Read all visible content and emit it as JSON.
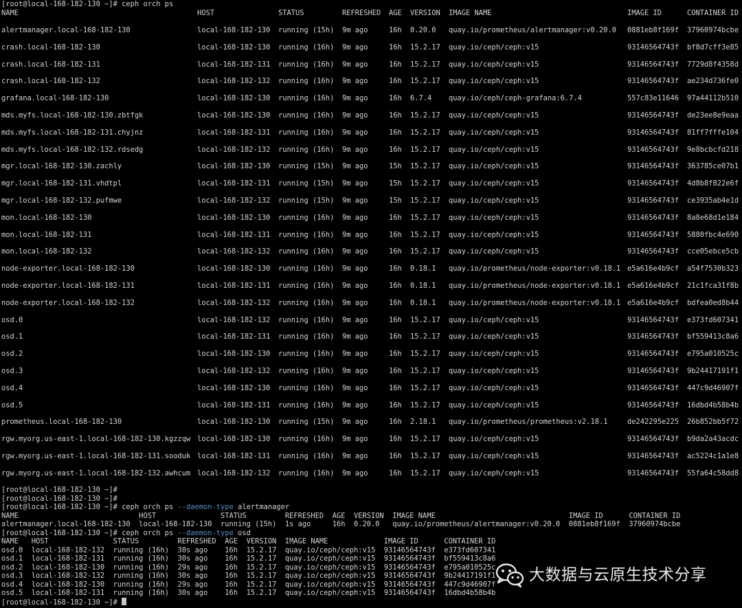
{
  "top_partial": "[root@local-168-182-130 ~]# ceph orch ps",
  "ps_all": {
    "headers": [
      "NAME",
      "HOST",
      "STATUS",
      "REFRESHED",
      "AGE",
      "VERSION",
      "IMAGE NAME",
      "IMAGE ID",
      "CONTAINER ID"
    ],
    "rows": [
      [
        "alertmanager.local-168-182-130",
        "local-168-182-130",
        "running (15h)",
        "9m ago",
        "16h",
        "0.20.0",
        "quay.io/prometheus/alertmanager:v0.20.0",
        "0881eb8f169f",
        "37960974bcbe"
      ],
      [
        "crash.local-168-182-130",
        "local-168-182-130",
        "running (16h)",
        "9m ago",
        "16h",
        "15.2.17",
        "quay.io/ceph/ceph:v15",
        "93146564743f",
        "bf8d7cff3e85"
      ],
      [
        "crash.local-168-182-131",
        "local-168-182-131",
        "running (16h)",
        "9m ago",
        "16h",
        "15.2.17",
        "quay.io/ceph/ceph:v15",
        "93146564743f",
        "7729d8f4358d"
      ],
      [
        "crash.local-168-182-132",
        "local-168-182-132",
        "running (16h)",
        "9m ago",
        "16h",
        "15.2.17",
        "quay.io/ceph/ceph:v15",
        "93146564743f",
        "ae234d736fe0"
      ],
      [
        "grafana.local-168-182-130",
        "local-168-182-130",
        "running (16h)",
        "9m ago",
        "16h",
        "6.7.4",
        "quay.io/ceph/ceph-grafana:6.7.4",
        "557c83e11646",
        "97a44112b510"
      ],
      [
        "mds.myfs.local-168-182-130.zbtfgk",
        "local-168-182-130",
        "running (16h)",
        "9m ago",
        "16h",
        "15.2.17",
        "quay.io/ceph/ceph:v15",
        "93146564743f",
        "de23ee8e9eaa"
      ],
      [
        "mds.myfs.local-168-182-131.chyjnz",
        "local-168-182-131",
        "running (16h)",
        "9m ago",
        "16h",
        "15.2.17",
        "quay.io/ceph/ceph:v15",
        "93146564743f",
        "81ff7fffe104"
      ],
      [
        "mds.myfs.local-168-182-132.rdsedg",
        "local-168-182-132",
        "running (16h)",
        "9m ago",
        "16h",
        "15.2.17",
        "quay.io/ceph/ceph:v15",
        "93146564743f",
        "9e8bcbcfd218"
      ],
      [
        "mgr.local-168-182-130.zachly",
        "local-168-182-130",
        "running (15h)",
        "9m ago",
        "15h",
        "15.2.17",
        "quay.io/ceph/ceph:v15",
        "93146564743f",
        "363785ce07b1"
      ],
      [
        "mgr.local-168-182-131.vhdtpl",
        "local-168-182-131",
        "running (15h)",
        "9m ago",
        "15h",
        "15.2.17",
        "quay.io/ceph/ceph:v15",
        "93146564743f",
        "4d8b8f822e6f"
      ],
      [
        "mgr.local-168-182-132.pufmwe",
        "local-168-182-132",
        "running (15h)",
        "9m ago",
        "15h",
        "15.2.17",
        "quay.io/ceph/ceph:v15",
        "93146564743f",
        "ce3935ab4e1d"
      ],
      [
        "mon.local-168-182-130",
        "local-168-182-130",
        "running (16h)",
        "9m ago",
        "16h",
        "15.2.17",
        "quay.io/ceph/ceph:v15",
        "93146564743f",
        "8a8e68d1e184"
      ],
      [
        "mon.local-168-182-131",
        "local-168-182-131",
        "running (16h)",
        "9m ago",
        "16h",
        "15.2.17",
        "quay.io/ceph/ceph:v15",
        "93146564743f",
        "5880fbc4e690"
      ],
      [
        "mon.local-168-182-132",
        "local-168-182-132",
        "running (16h)",
        "9m ago",
        "16h",
        "15.2.17",
        "quay.io/ceph/ceph:v15",
        "93146564743f",
        "cce05ebce5cb"
      ],
      [
        "node-exporter.local-168-182-130",
        "local-168-182-130",
        "running (16h)",
        "9m ago",
        "16h",
        "0.18.1",
        "quay.io/prometheus/node-exporter:v0.18.1",
        "e5a616e4b9cf",
        "a54f7530b323"
      ],
      [
        "node-exporter.local-168-182-131",
        "local-168-182-131",
        "running (16h)",
        "9m ago",
        "16h",
        "0.18.1",
        "quay.io/prometheus/node-exporter:v0.18.1",
        "e5a616e4b9cf",
        "21c1fca31f8b"
      ],
      [
        "node-exporter.local-168-182-132",
        "local-168-182-132",
        "running (16h)",
        "9m ago",
        "16h",
        "0.18.1",
        "quay.io/prometheus/node-exporter:v0.18.1",
        "e5a616e4b9cf",
        "bdfea0ed8b44"
      ],
      [
        "osd.0",
        "local-168-182-132",
        "running (16h)",
        "9m ago",
        "16h",
        "15.2.17",
        "quay.io/ceph/ceph:v15",
        "93146564743f",
        "e373fd607341"
      ],
      [
        "osd.1",
        "local-168-182-131",
        "running (16h)",
        "9m ago",
        "16h",
        "15.2.17",
        "quay.io/ceph/ceph:v15",
        "93146564743f",
        "bf559413c8a6"
      ],
      [
        "osd.2",
        "local-168-182-130",
        "running (16h)",
        "9m ago",
        "16h",
        "15.2.17",
        "quay.io/ceph/ceph:v15",
        "93146564743f",
        "e795a010525c"
      ],
      [
        "osd.3",
        "local-168-182-132",
        "running (16h)",
        "9m ago",
        "16h",
        "15.2.17",
        "quay.io/ceph/ceph:v15",
        "93146564743f",
        "9b24417191f1"
      ],
      [
        "osd.4",
        "local-168-182-130",
        "running (16h)",
        "9m ago",
        "16h",
        "15.2.17",
        "quay.io/ceph/ceph:v15",
        "93146564743f",
        "447c9d46907f"
      ],
      [
        "osd.5",
        "local-168-182-131",
        "running (16h)",
        "9m ago",
        "16h",
        "15.2.17",
        "quay.io/ceph/ceph:v15",
        "93146564743f",
        "16dbd4b58b4b"
      ],
      [
        "prometheus.local-168-182-130",
        "local-168-182-130",
        "running (15h)",
        "9m ago",
        "16h",
        "2.18.1",
        "quay.io/prometheus/prometheus:v2.18.1",
        "de242295e225",
        "26b852bb5f72"
      ],
      [
        "rgw.myorg.us-east-1.local-168-182-130.kgzzqw",
        "local-168-182-130",
        "running (16h)",
        "9m ago",
        "16h",
        "15.2.17",
        "quay.io/ceph/ceph:v15",
        "93146564743f",
        "b9da2a43acdc"
      ],
      [
        "rgw.myorg.us-east-1.local-168-182-131.sooduk",
        "local-168-182-131",
        "running (16h)",
        "9m ago",
        "16h",
        "15.2.17",
        "quay.io/ceph/ceph:v15",
        "93146564743f",
        "ac5224c1a1e8"
      ],
      [
        "rgw.myorg.us-east-1.local-168-182-132.awhcum",
        "local-168-182-132",
        "running (16h)",
        "9m ago",
        "16h",
        "15.2.17",
        "quay.io/ceph/ceph:v15",
        "93146564743f",
        "55fa64c58dd8"
      ]
    ]
  },
  "prompt": "[root@local-168-182-130 ~]# ",
  "cmd_alert": {
    "base": "ceph orch ps ",
    "opt": "--daemon-type",
    "arg": " alertmanager"
  },
  "alert_header": "NAME                            HOST               STATUS         REFRESHED  AGE  VERSION  IMAGE NAME                               IMAGE ID      CONTAINER ID",
  "alert_row": "alertmanager.local-168-182-130  local-168-182-130  running (15h)  1s ago     16h  0.20.0   quay.io/prometheus/alertmanager:v0.20.0  0881eb8f169f  37960974bcbe",
  "cmd_osd": {
    "base": "ceph orch ps ",
    "opt": "--daemon-type",
    "arg": " osd"
  },
  "osd_header": "NAME   HOST               STATUS         REFRESHED  AGE  VERSION  IMAGE NAME             IMAGE ID      CONTAINER ID",
  "osd_rows": [
    "osd.0  local-168-182-132  running (16h)  30s ago    16h  15.2.17  quay.io/ceph/ceph:v15  93146564743f  e373fd607341",
    "osd.1  local-168-182-131  running (16h)  30s ago    16h  15.2.17  quay.io/ceph/ceph:v15  93146564743f  bf559413c8a6",
    "osd.2  local-168-182-130  running (16h)  29s ago    16h  15.2.17  quay.io/ceph/ceph:v15  93146564743f  e795a010525c",
    "osd.3  local-168-182-132  running (16h)  30s ago    16h  15.2.17  quay.io/ceph/ceph:v15  93146564743f  9b24417191f1",
    "osd.4  local-168-182-130  running (16h)  29s ago    16h  15.2.17  quay.io/ceph/ceph:v15  93146564743f  447c9d46907f",
    "osd.5  local-168-182-131  running (16h)  30s ago    16h  15.2.17  quay.io/ceph/ceph:v15  93146564743f  16dbd4b58b4b"
  ],
  "watermark": {
    "text": "大数据与云原生技术分享",
    "icon": "wechat-icon"
  },
  "colors": {
    "background": "#000000",
    "text": "#d4d4d4",
    "option": "#5a8fc4"
  }
}
